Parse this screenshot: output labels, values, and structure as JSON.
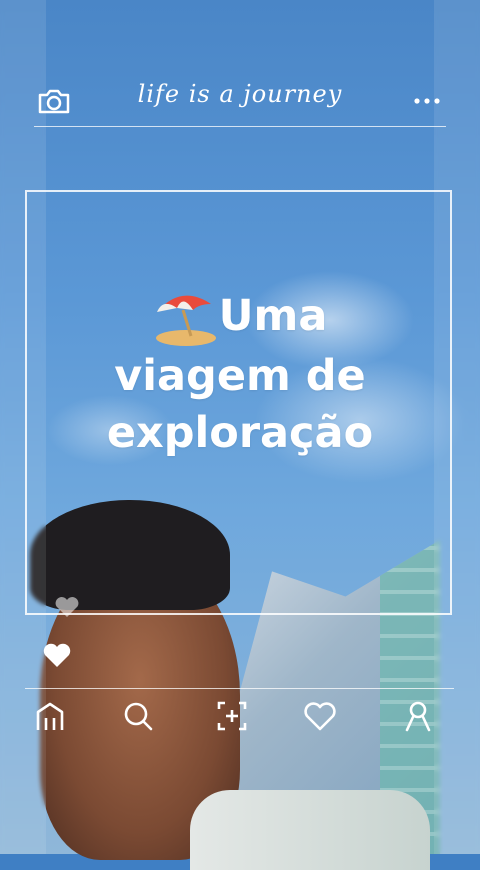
{
  "header": {
    "title": "life is a journey",
    "camera_icon": "camera-icon",
    "more_icon": "more-horizontal-icon"
  },
  "main": {
    "headline_emoji": "beach-umbrella-emoji",
    "headline_lines": [
      "Uma",
      "viagem de",
      "exploração"
    ]
  },
  "reactions": {
    "small_heart_icon": "heart-icon",
    "filled_heart_icon": "heart-filled-icon"
  },
  "nav": {
    "items": [
      {
        "icon": "home-icon"
      },
      {
        "icon": "search-icon"
      },
      {
        "icon": "add-post-icon"
      },
      {
        "icon": "heart-outline-icon"
      },
      {
        "icon": "profile-icon"
      }
    ]
  },
  "colors": {
    "sky": "#4a86c7",
    "foreground": "#ffffff"
  }
}
